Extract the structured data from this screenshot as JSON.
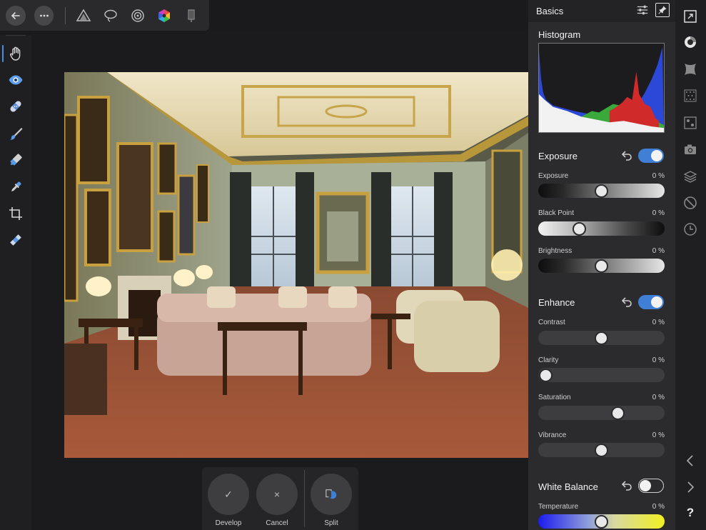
{
  "panel": {
    "title": "Basics",
    "histogram_title": "Histogram"
  },
  "ctxbar": {
    "develop_label": "Develop",
    "cancel_label": "Cancel",
    "split_label": "Split",
    "develop_glyph": "✓",
    "cancel_glyph": "×"
  },
  "sections": {
    "exposure": {
      "title": "Exposure",
      "enabled": true,
      "sliders": [
        {
          "label": "Exposure",
          "value": "0 %",
          "position": 0.5
        },
        {
          "label": "Black Point",
          "value": "0 %",
          "position": 0.3
        },
        {
          "label": "Brightness",
          "value": "0 %",
          "position": 0.5
        }
      ]
    },
    "enhance": {
      "title": "Enhance",
      "enabled": true,
      "sliders": [
        {
          "label": "Contrast",
          "value": "0 %",
          "position": 0.5
        },
        {
          "label": "Clarity",
          "value": "0 %",
          "position": 0.0
        },
        {
          "label": "Saturation",
          "value": "0 %",
          "position": 0.65
        },
        {
          "label": "Vibrance",
          "value": "0 %",
          "position": 0.5
        }
      ]
    },
    "white_balance": {
      "title": "White Balance",
      "enabled": false,
      "sliders": [
        {
          "label": "Temperature",
          "value": "0 %",
          "position": 0.5
        }
      ]
    }
  },
  "help_label": "?",
  "colors": {
    "accent": "#3f7fd6",
    "panel_bg": "#2b2b2d",
    "histogram_blue": "#2b49d6",
    "histogram_green": "#3aa83a",
    "histogram_red": "#d02a2a"
  }
}
